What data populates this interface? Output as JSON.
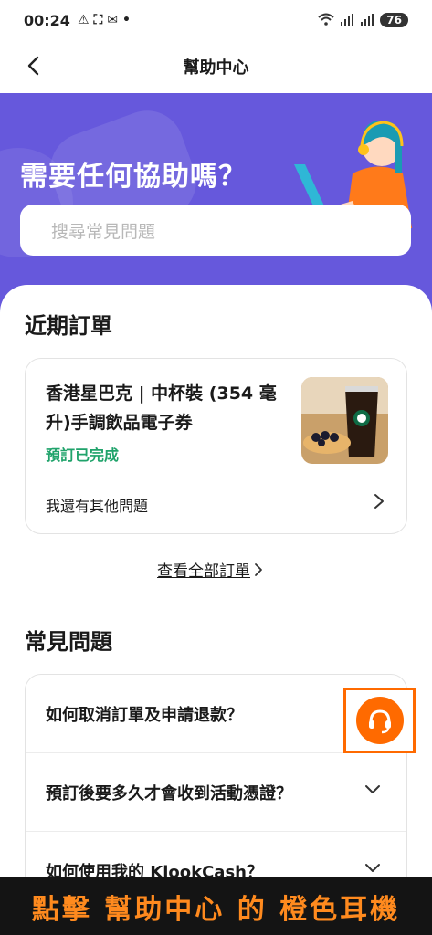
{
  "status_bar": {
    "time": "00:24",
    "battery": "76"
  },
  "nav": {
    "title": "幫助中心"
  },
  "hero": {
    "title": "需要任何協助嗎？",
    "search_placeholder": "搜尋常見問題"
  },
  "recent_orders": {
    "title": "近期訂單",
    "order": {
      "name": "香港星巴克 | 中杯裝 (354 毫升)手調飲品電子券",
      "status": "預訂已完成",
      "other_question": "我還有其他問題"
    },
    "view_all": "查看全部訂單"
  },
  "faq": {
    "title": "常見問題",
    "items": [
      {
        "question": "如何取消訂單及申請退款？"
      },
      {
        "question": "預訂後要多久才會收到活動憑證？"
      },
      {
        "question": "如何使用我的 KlookCash？"
      }
    ]
  },
  "caption": "點擊 幫助中心 的 橙色耳機",
  "colors": {
    "hero": "#6658dc",
    "accent": "#ff6a00",
    "success": "#20a36b",
    "caption_text": "#ff8a1e"
  }
}
